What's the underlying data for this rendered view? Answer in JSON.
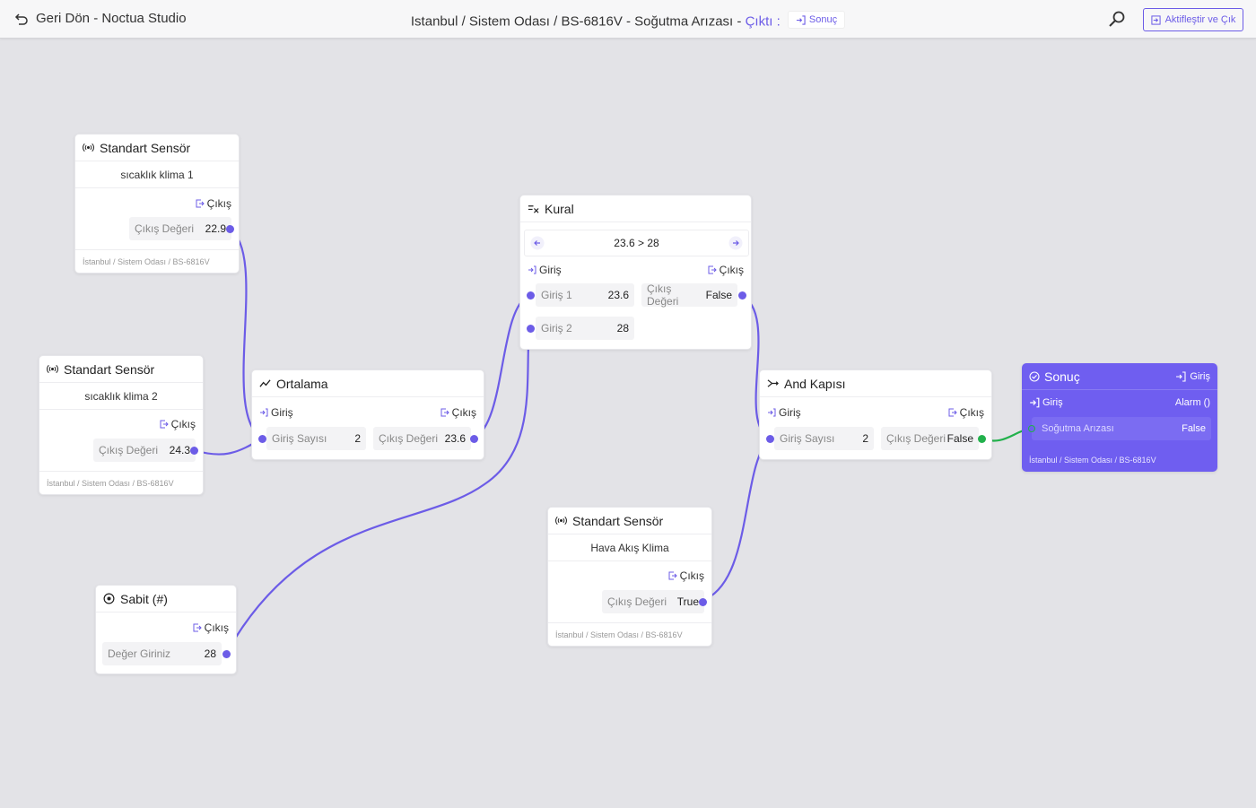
{
  "topbar": {
    "back_label": "Geri Dön - Noctua Studio",
    "breadcrumb": "Istanbul / Sistem Odası / BS-6816V - Soğutma Arızası - ",
    "output_label": "Çıktı :",
    "output_tag": "Sonuç",
    "activate_label": "Aktifleştir ve Çık"
  },
  "nodes": {
    "sensor1": {
      "title": "Standart Sensör",
      "name": "sıcaklık klima 1",
      "out": "Çıkış",
      "field_label": "Çıkış Değeri",
      "value": "22.9",
      "footer": "İstanbul / Sistem Odası / BS-6816V"
    },
    "sensor2": {
      "title": "Standart Sensör",
      "name": "sıcaklık klima 2",
      "out": "Çıkış",
      "field_label": "Çıkış Değeri",
      "value": "24.3",
      "footer": "İstanbul / Sistem Odası / BS-6816V"
    },
    "sensor3": {
      "title": "Standart Sensör",
      "name": "Hava Akış Klima",
      "out": "Çıkış",
      "field_label": "Çıkış Değeri",
      "value": "True",
      "footer": "İstanbul / Sistem Odası / BS-6816V"
    },
    "average": {
      "title": "Ortalama",
      "in": "Giriş",
      "out": "Çıkış",
      "in_label": "Giriş Sayısı",
      "in_value": "2",
      "out_label": "Çıkış Değeri",
      "out_value": "23.6"
    },
    "rule": {
      "title": "Kural",
      "expression": "23.6 > 28",
      "in": "Giriş",
      "out": "Çıkış",
      "in1_label": "Giriş 1",
      "in1_value": "23.6",
      "in2_label": "Giriş 2",
      "in2_value": "28",
      "out_label": "Çıkış Değeri",
      "out_value": "False"
    },
    "and_gate": {
      "title": "And Kapısı",
      "in": "Giriş",
      "out": "Çıkış",
      "in_label": "Giriş Sayısı",
      "in_value": "2",
      "out_label": "Çıkış Değeri",
      "out_value": "False"
    },
    "constant": {
      "title": "Sabit (#)",
      "out": "Çıkış",
      "field_label": "Değer Giriniz",
      "value": "28"
    },
    "result": {
      "title": "Sonuç",
      "in_badge": "Giriş",
      "in": "Giriş",
      "alarm": "Alarm ()",
      "field_label": "Soğutma Arızası",
      "value": "False",
      "footer": "İstanbul / Sistem Odası / BS-6816V"
    }
  },
  "colors": {
    "accent": "#6c5ce7",
    "wire": "#6c5ce7",
    "wire_active": "#22b14c",
    "result_bg": "#6f5ef0"
  }
}
